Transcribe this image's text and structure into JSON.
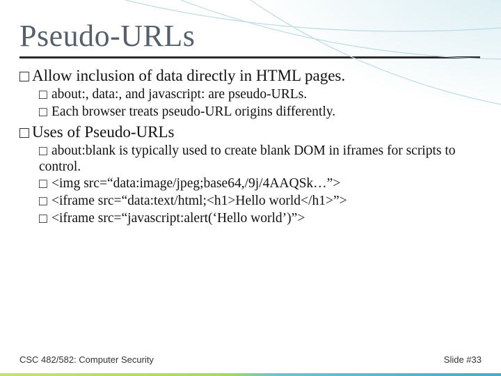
{
  "title": "Pseudo-URLs",
  "bullets": {
    "l1a": "Allow inclusion of data directly in HTML pages.",
    "l2a": "about:, data:, and javascript: are pseudo-URLs.",
    "l2b": "Each browser treats pseudo-URL origins differently.",
    "l1b": "Uses of Pseudo-URLs",
    "l2c": "about:blank is typically used to create blank DOM in iframes for scripts to control.",
    "l2d": "<img src=“data:image/jpeg;base64,/9j/4AAQSk…”>",
    "l2e": "<iframe src=“data:text/html;<h1>Hello world</h1>”>",
    "l2f": "<iframe src=“javascript:alert(‘Hello world’)”>"
  },
  "marker": "□",
  "footer": {
    "left": "CSC 482/582: Computer Security",
    "right": "Slide #33"
  }
}
